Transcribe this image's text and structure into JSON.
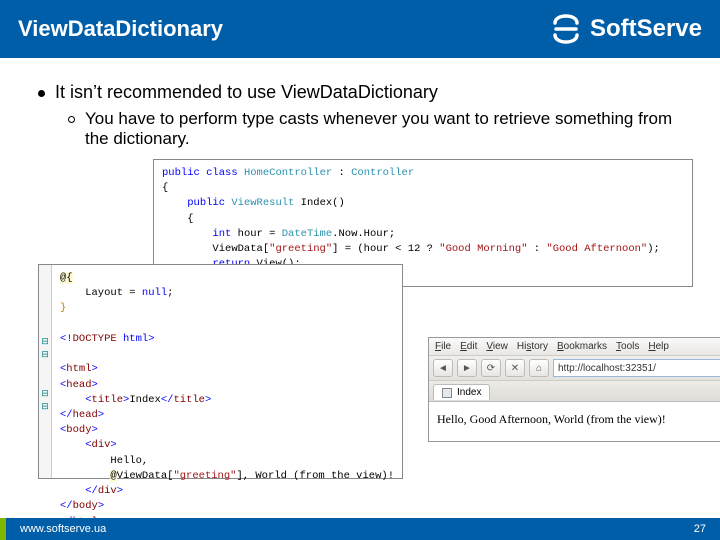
{
  "header": {
    "title": "ViewDataDictionary",
    "brand": "SoftServe"
  },
  "bullets": {
    "l1": "It isn’t recommended to use ViewDataDictionary",
    "l2": "You have to perform type casts whenever you want to retrieve something from the dictionary."
  },
  "code": {
    "controller": {
      "l1a": "public",
      "l1b": "class",
      "l1c": "HomeController",
      "l1d": ":",
      "l1e": "Controller",
      "l2": "{",
      "l3a": "public",
      "l3b": "ViewResult",
      "l3c": "Index()",
      "l4": "{",
      "l5a": "int",
      "l5b": "hour = ",
      "l5c": "DateTime",
      "l5d": ".Now.Hour;",
      "l6a": "ViewData[",
      "l6b": "\"greeting\"",
      "l6c": "] = (hour < 12 ? ",
      "l6d": "\"Good Morning\"",
      "l6e": " : ",
      "l6f": "\"Good Afternoon\"",
      "l6g": ");",
      "l7a": "return",
      "l7b": " View();",
      "l8": "}",
      "l9": "}"
    },
    "razor": {
      "l1a": "@{",
      "l2a": "Layout = ",
      "l2b": "null",
      "l2c": ";",
      "l3": "}",
      "l5a": "<!",
      "l5b": "DOCTYPE",
      "l5c": " html",
      "l5d": ">",
      "l7a": "<",
      "l7b": "html",
      "l7c": ">",
      "l8a": "<",
      "l8b": "head",
      "l8c": ">",
      "l9a": "<",
      "l9b": "title",
      "l9c": ">",
      "l9d": "Index",
      "l9e": "</",
      "l9f": "title",
      "l9g": ">",
      "l10a": "</",
      "l10b": "head",
      "l10c": ">",
      "l11a": "<",
      "l11b": "body",
      "l11c": ">",
      "l12a": "<",
      "l12b": "div",
      "l12c": ">",
      "l13": "Hello,",
      "l14a": "@",
      "l14b": "ViewData[",
      "l14c": "\"greeting\"",
      "l14d": "]",
      "l14e": ", World (from the view)!",
      "l15a": "</",
      "l15b": "div",
      "l15c": ">",
      "l16a": "</",
      "l16b": "body",
      "l16c": ">",
      "l17a": "</",
      "l17b": "html",
      "l17c": ">"
    }
  },
  "browser": {
    "menu": {
      "file": "File",
      "edit": "Edit",
      "view": "View",
      "history": "History",
      "bookmarks": "Bookmarks",
      "tools": "Tools",
      "help": "Help"
    },
    "url": "http://localhost:32351/",
    "tab": "Index",
    "page_text": "Hello, Good Afternoon, World (from the view)!"
  },
  "footer": {
    "site": "www.softserve.ua",
    "page": "27"
  }
}
